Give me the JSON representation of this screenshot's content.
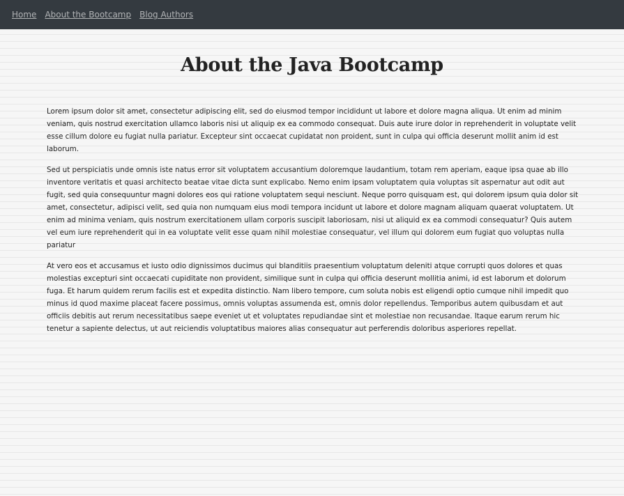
{
  "nav": {
    "links": [
      {
        "label": "Home"
      },
      {
        "label": "About the Bootcamp"
      },
      {
        "label": "Blog Authors"
      }
    ]
  },
  "page": {
    "title": "About the Java Bootcamp",
    "paragraphs": [
      "Lorem ipsum dolor sit amet, consectetur adipiscing elit, sed do eiusmod tempor incididunt ut labore et dolore magna aliqua. Ut enim ad minim veniam, quis nostrud exercitation ullamco laboris nisi ut aliquip ex ea commodo consequat. Duis aute irure dolor in reprehenderit in voluptate velit esse cillum dolore eu fugiat nulla pariatur. Excepteur sint occaecat cupidatat non proident, sunt in culpa qui officia deserunt mollit anim id est laborum.",
      "Sed ut perspiciatis unde omnis iste natus error sit voluptatem accusantium doloremque laudantium, totam rem aperiam, eaque ipsa quae ab illo inventore veritatis et quasi architecto beatae vitae dicta sunt explicabo. Nemo enim ipsam voluptatem quia voluptas sit aspernatur aut odit aut fugit, sed quia consequuntur magni dolores eos qui ratione voluptatem sequi nesciunt. Neque porro quisquam est, qui dolorem ipsum quia dolor sit amet, consectetur, adipisci velit, sed quia non numquam eius modi tempora incidunt ut labore et dolore magnam aliquam quaerat voluptatem. Ut enim ad minima veniam, quis nostrum exercitationem ullam corporis suscipit laboriosam, nisi ut aliquid ex ea commodi consequatur? Quis autem vel eum iure reprehenderit qui in ea voluptate velit esse quam nihil molestiae consequatur, vel illum qui dolorem eum fugiat quo voluptas nulla pariatur",
      "At vero eos et accusamus et iusto odio dignissimos ducimus qui blanditiis praesentium voluptatum deleniti atque corrupti quos dolores et quas molestias excepturi sint occaecati cupiditate non provident, similique sunt in culpa qui officia deserunt mollitia animi, id est laborum et dolorum fuga. Et harum quidem rerum facilis est et expedita distinctio. Nam libero tempore, cum soluta nobis est eligendi optio cumque nihil impedit quo minus id quod maxime placeat facere possimus, omnis voluptas assumenda est, omnis dolor repellendus. Temporibus autem quibusdam et aut officiis debitis aut rerum necessitatibus saepe eveniet ut et voluptates repudiandae sint et molestiae non recusandae. Itaque earum rerum hic tenetur a sapiente delectus, ut aut reiciendis voluptatibus maiores alias consequatur aut perferendis doloribus asperiores repellat."
    ]
  },
  "colors": {
    "navbar_bg": "#343a40",
    "nav_link": "#b2b4b6",
    "text": "#222222",
    "page_bg": "#f3f3f3"
  }
}
